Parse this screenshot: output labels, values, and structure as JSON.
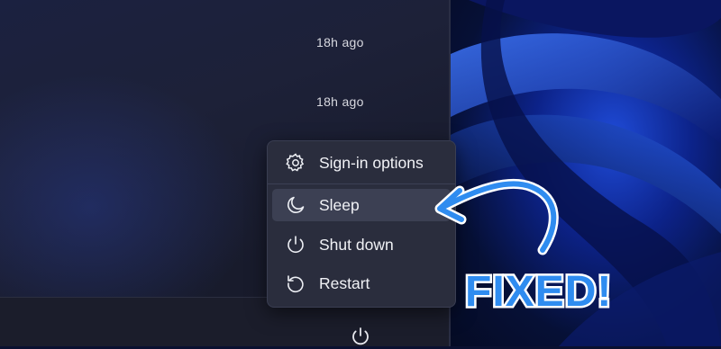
{
  "notifications": [
    {
      "time": "18h ago"
    },
    {
      "time": "18h ago"
    }
  ],
  "power_menu": {
    "items": [
      {
        "label": "Sign-in options",
        "icon": "gear-icon"
      },
      {
        "label": "Sleep",
        "icon": "moon-icon",
        "highlighted": true
      },
      {
        "label": "Shut down",
        "icon": "power-icon"
      },
      {
        "label": "Restart",
        "icon": "restart-icon"
      }
    ]
  },
  "footer": {
    "power_icon": "power-icon"
  },
  "annotation": {
    "text": "FIXED!",
    "color": "#2f8cf0"
  }
}
